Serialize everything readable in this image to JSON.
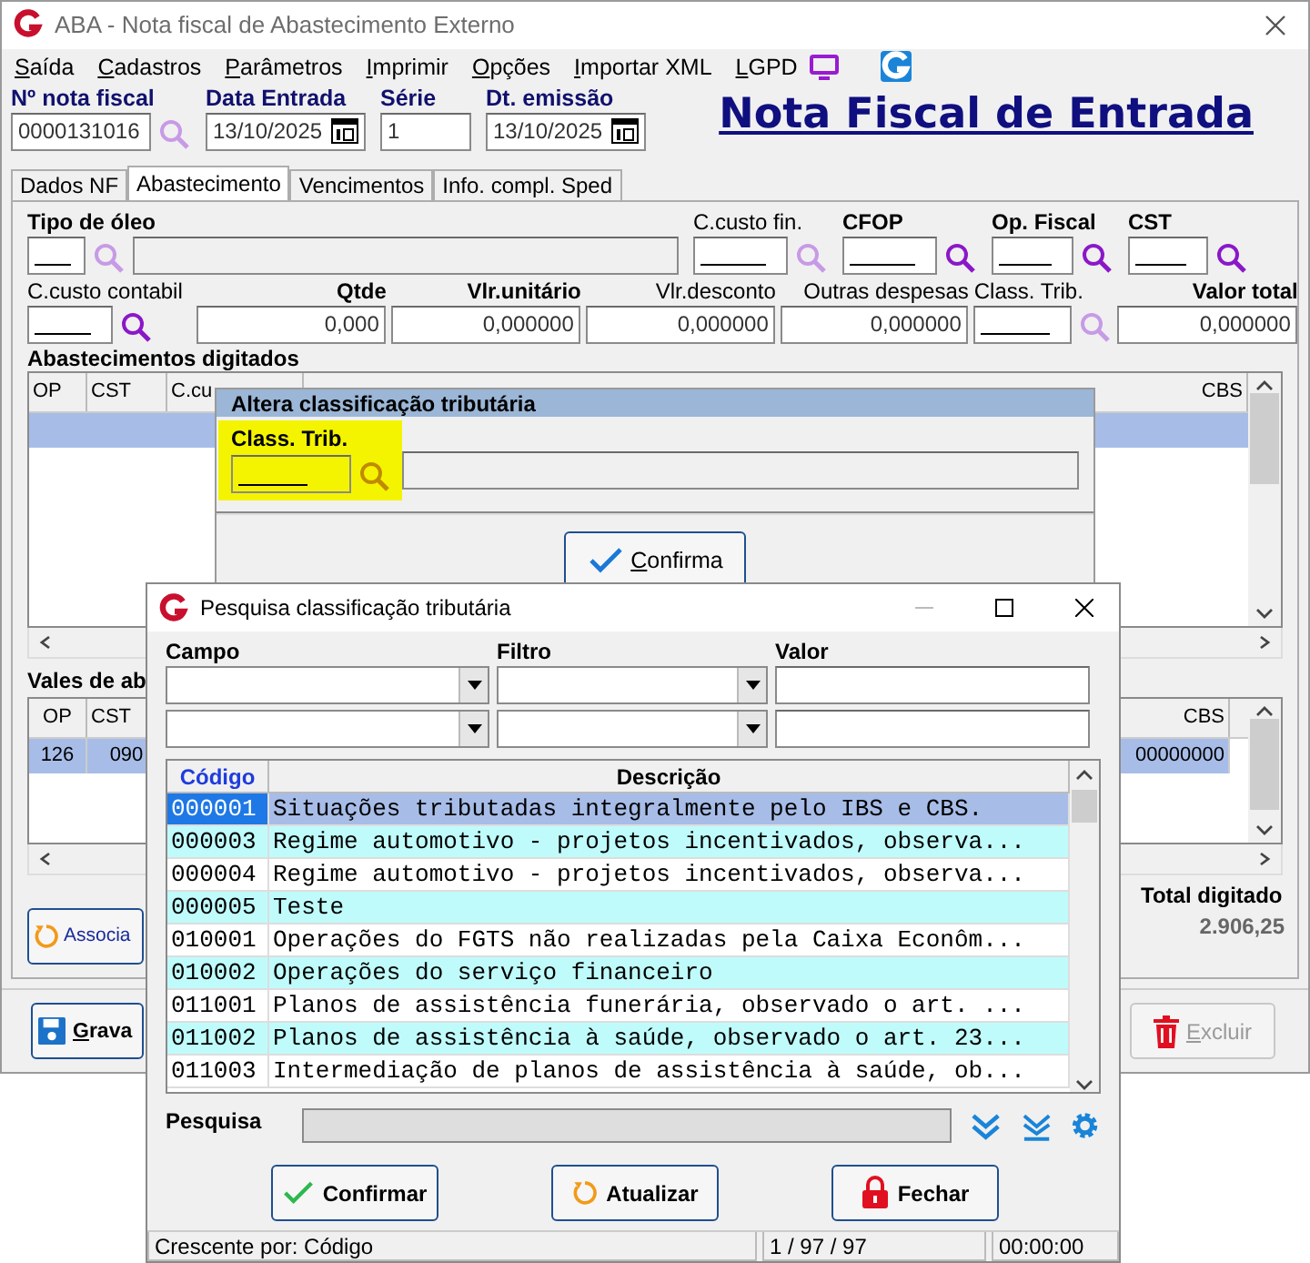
{
  "main_window": {
    "title": "ABA - Nota fiscal de Abastecimento Externo",
    "menu": [
      "Saída",
      "Cadastros",
      "Parâmetros",
      "Imprimir",
      "Opções",
      "Importar XML",
      "LGPD"
    ],
    "header_fields": [
      {
        "label": "Nº nota fiscal",
        "value": "0000131016",
        "kind": "lookup",
        "lookup_enabled": false
      },
      {
        "label": "Data Entrada",
        "value": "13/10/2025",
        "kind": "date"
      },
      {
        "label": "Série",
        "value": "1",
        "kind": "text"
      },
      {
        "label": "Dt. emissão",
        "value": "13/10/2025",
        "kind": "date"
      }
    ],
    "page_title": "Nota Fiscal de Entrada",
    "tabs": [
      {
        "label": "Dados NF",
        "selected": false
      },
      {
        "label": "Abastecimento",
        "selected": true
      },
      {
        "label": "Vencimentos",
        "selected": false
      },
      {
        "label": "Info. compl. Sped",
        "selected": false
      }
    ],
    "row1": [
      {
        "label": "Tipo de óleo",
        "required": true,
        "lookup_enabled": false,
        "kind": "code_desc"
      },
      {
        "label": "C.custo fin.",
        "required": false,
        "lookup_enabled": false,
        "kind": "code"
      },
      {
        "label": "CFOP",
        "required": true,
        "lookup_enabled": true,
        "kind": "code"
      },
      {
        "label": "Op. Fiscal",
        "required": true,
        "lookup_enabled": true,
        "kind": "code"
      },
      {
        "label": "CST",
        "required": true,
        "lookup_enabled": true,
        "kind": "code"
      }
    ],
    "row2": [
      {
        "label": "C.custo contabil",
        "required": false,
        "lookup_enabled": true,
        "kind": "code"
      },
      {
        "label": "Qtde",
        "required": true,
        "value": "0,000",
        "kind": "number"
      },
      {
        "label": "Vlr.unitário",
        "required": true,
        "value": "0,000000",
        "kind": "number"
      },
      {
        "label": "Vlr.desconto",
        "required": false,
        "value": "0,000000",
        "kind": "number"
      },
      {
        "label": "Outras despesas",
        "required": false,
        "value": "0,000000",
        "kind": "number"
      },
      {
        "label": "Class. Trib.",
        "required": false,
        "lookup_enabled": false,
        "kind": "code"
      },
      {
        "label": "Valor total",
        "required": true,
        "value": "0,000000",
        "kind": "number"
      }
    ],
    "grid1": {
      "title": "Abastecimentos digitados",
      "columns": [
        "OP",
        "CST",
        "C.cu",
        "CBS"
      ],
      "rows": [
        {
          "selected": true
        }
      ]
    },
    "grid2": {
      "title": "Vales de ab",
      "columns": [
        "OP",
        "CST",
        "CBS"
      ],
      "rows": [
        {
          "cells": [
            "126",
            "090",
            "00000000"
          ],
          "selected": true
        }
      ]
    },
    "associate_button": "Associa",
    "total": {
      "label": "Total digitado",
      "value": "2.906,25"
    },
    "save_button": {
      "label": "Grava",
      "disabled": false
    },
    "delete_button": {
      "label": "Excluir",
      "disabled": true
    }
  },
  "dialog": {
    "title": "Altera classificação tributária",
    "field_label": "Class. Trib.",
    "focused": true,
    "button": "Confirma"
  },
  "search_window": {
    "title": "Pesquisa classificação tributária",
    "filter_labels": [
      "Campo",
      "Filtro",
      "Valor"
    ],
    "columns": [
      {
        "label": "Código",
        "sorted": true
      },
      {
        "label": "Descrição",
        "sorted": false
      }
    ],
    "rows": [
      {
        "code": "000001",
        "description": "Situações tributadas integralmente pelo IBS e CBS.",
        "selected": true
      },
      {
        "code": "000003",
        "description": "Regime automotivo - projetos incentivados, observa...",
        "selected": false
      },
      {
        "code": "000004",
        "description": "Regime automotivo - projetos incentivados, observa...",
        "selected": false
      },
      {
        "code": "000005",
        "description": "Teste",
        "selected": false
      },
      {
        "code": "010001",
        "description": "Operações do FGTS não realizadas pela Caixa Econôm...",
        "selected": false
      },
      {
        "code": "010002",
        "description": "Operações do serviço financeiro",
        "selected": false
      },
      {
        "code": "011001",
        "description": "Planos de assistência funerária, observado o art. ...",
        "selected": false
      },
      {
        "code": "011002",
        "description": "Planos de assistência à saúde, observado o art. 23...",
        "selected": false
      },
      {
        "code": "011003",
        "description": "Intermediação de planos de assistência à saúde, ob...",
        "selected": false
      }
    ],
    "search_label": "Pesquisa",
    "buttons": [
      {
        "label": "Confirmar",
        "kind": "confirm"
      },
      {
        "label": "Atualizar",
        "kind": "refresh"
      },
      {
        "label": "Fechar",
        "kind": "close"
      }
    ],
    "status": [
      "Crescente por: Código",
      "1 / 97 / 97",
      "00:00:00"
    ]
  }
}
